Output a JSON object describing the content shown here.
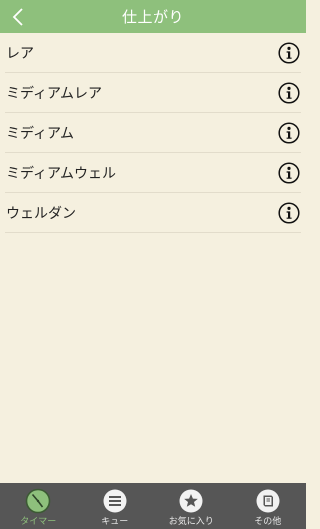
{
  "header": {
    "title": "仕上がり"
  },
  "list": {
    "items": [
      {
        "label": "レア"
      },
      {
        "label": "ミディアムレア"
      },
      {
        "label": "ミディアム"
      },
      {
        "label": "ミディアムウェル"
      },
      {
        "label": "ウェルダン"
      }
    ]
  },
  "tabbar": {
    "tabs": [
      {
        "label": "タイマー",
        "icon": "clock-icon",
        "active": true
      },
      {
        "label": "キュー",
        "icon": "list-icon",
        "active": false
      },
      {
        "label": "お気に入り",
        "icon": "star-icon",
        "active": false
      },
      {
        "label": "その他",
        "icon": "book-icon",
        "active": false
      }
    ]
  },
  "colors": {
    "header_bg": "#8ec07c",
    "page_bg": "#f5f0df",
    "tabbar_bg": "#565656",
    "active_tab": "#8ec07c"
  }
}
